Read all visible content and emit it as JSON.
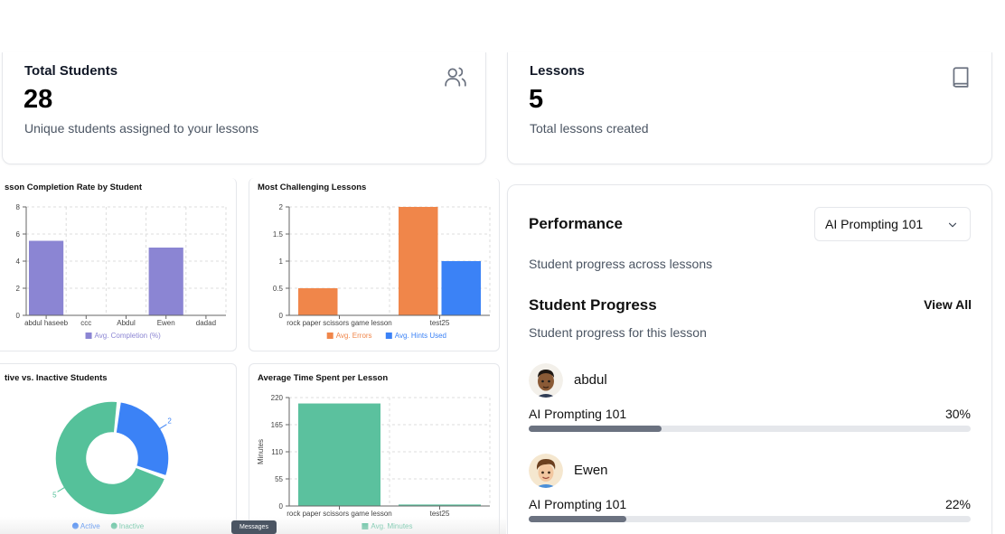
{
  "stats": {
    "total_students": {
      "title": "Total Students",
      "value": "28",
      "desc": "Unique students assigned to your lessons",
      "icon": "users-icon"
    },
    "lessons": {
      "title": "Lessons",
      "value": "5",
      "desc": "Total lessons created",
      "icon": "book-icon"
    }
  },
  "charts": {
    "completion": {
      "title": "sson Completion Rate by Student"
    },
    "challenging": {
      "title": "Most Challenging Lessons"
    },
    "active": {
      "title": "tive vs. Inactive Students"
    },
    "time": {
      "title": "Average Time Spent per Lesson"
    }
  },
  "chart_data": [
    {
      "id": "completion",
      "type": "bar",
      "title": "sson Completion Rate by Student",
      "categories": [
        "abdul haseeb",
        "ccc",
        "Abdul",
        "Ewen",
        "dadad"
      ],
      "series": [
        {
          "name": "Avg. Completion (%)",
          "color": "#8b85d3",
          "values": [
            5.5,
            0,
            0,
            5,
            0
          ]
        }
      ],
      "x_tick_labels": [
        "abdul haseeb",
        "ccc",
        "Abdul",
        "Ewen",
        "dadad"
      ],
      "yticks": [
        0,
        2,
        4,
        6,
        8
      ],
      "ylim": [
        0,
        8
      ],
      "grid": true,
      "legend": "bottom"
    },
    {
      "id": "challenging",
      "type": "bar",
      "title": "Most Challenging Lessons",
      "categories": [
        "rock paper scissors game lesson",
        "test25"
      ],
      "series": [
        {
          "name": "Avg. Errors",
          "color": "#f0864a",
          "values": [
            0.5,
            2
          ]
        },
        {
          "name": "Avg. Hints Used",
          "color": "#3b82f6",
          "values": [
            0,
            1
          ]
        }
      ],
      "yticks": [
        0,
        0.5,
        1,
        1.5,
        2
      ],
      "ytick_labels": [
        "0",
        "0.5",
        "1",
        "1.5",
        "2"
      ],
      "ylim": [
        0,
        2
      ],
      "grid": true,
      "legend": "bottom"
    },
    {
      "id": "active",
      "type": "pie",
      "title": "tive vs. Inactive Students",
      "donut": true,
      "labels": [
        "Active",
        "Inactive"
      ],
      "values": [
        2,
        5
      ],
      "value_labels": [
        "2",
        "5"
      ],
      "colors": [
        "#3b82f6",
        "#55c19a"
      ],
      "legend": "bottom"
    },
    {
      "id": "time",
      "type": "bar",
      "title": "Average Time Spent per Lesson",
      "categories": [
        "rock paper scissors game lesson",
        "test25"
      ],
      "series": [
        {
          "name": "Avg. Minutes",
          "color": "#5bc19e",
          "values": [
            208,
            3
          ]
        }
      ],
      "ylabel": "Minutes",
      "yticks": [
        0,
        55,
        110,
        165,
        220
      ],
      "ylim": [
        0,
        220
      ],
      "grid": true,
      "legend": "bottom"
    }
  ],
  "performance": {
    "title": "Performance",
    "select_value": "AI Prompting 101",
    "desc": "Student progress across lessons"
  },
  "student_progress": {
    "title": "Student Progress",
    "view_all": "View All",
    "desc": "Student progress for this lesson",
    "students": [
      {
        "name": "abdul",
        "lesson": "AI Prompting 101",
        "percent_label": "30%",
        "progress": 0.3,
        "avatar": "avatar-dark-skin-man"
      },
      {
        "name": "Ewen",
        "lesson": "AI Prompting 101",
        "percent_label": "22%",
        "progress": 0.22,
        "avatar": "avatar-brown-hair-man"
      }
    ]
  },
  "messages_label": "Messages"
}
